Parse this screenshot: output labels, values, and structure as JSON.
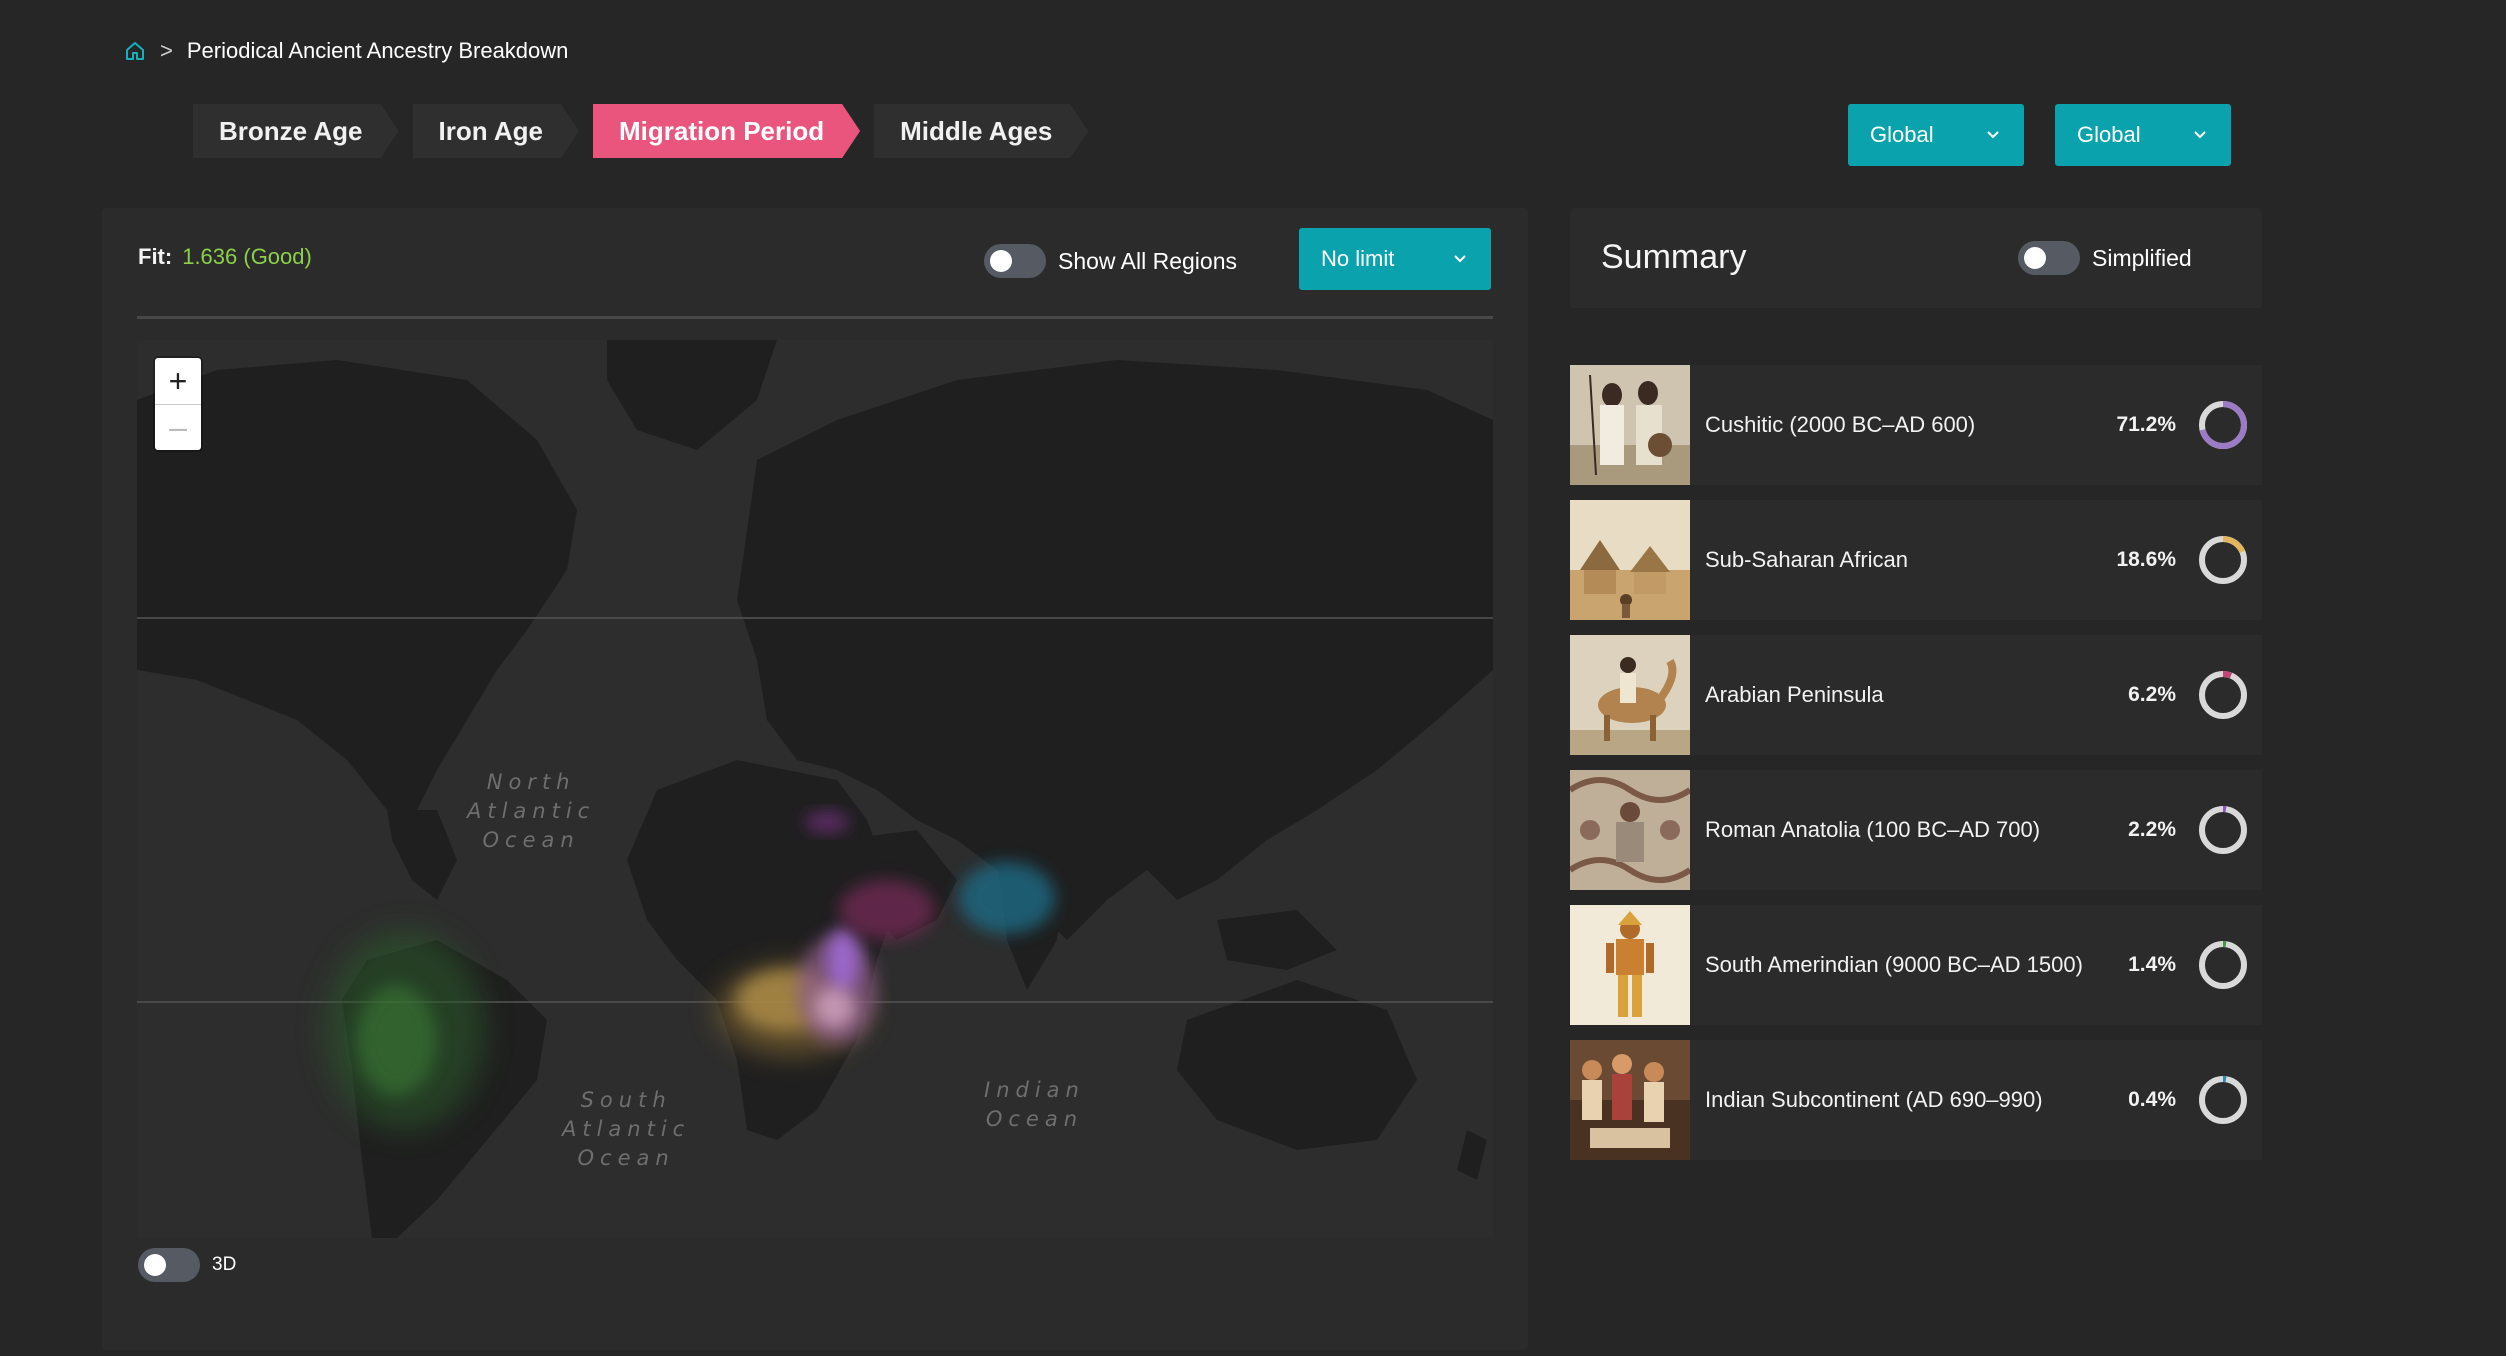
{
  "breadcrumb": {
    "home_icon": "home-icon",
    "separator": ">",
    "title": "Periodical Ancient Ancestry Breakdown"
  },
  "tabs": [
    {
      "label": "Bronze Age",
      "active": false
    },
    {
      "label": "Iron Age",
      "active": false
    },
    {
      "label": "Migration Period",
      "active": true
    },
    {
      "label": "Middle Ages",
      "active": false
    }
  ],
  "region_dropdowns": [
    {
      "value": "Global"
    },
    {
      "value": "Global"
    }
  ],
  "map_panel": {
    "fit_label": "Fit:",
    "fit_value": "1.636 (Good)",
    "show_all_regions_label": "Show All Regions",
    "limit_dropdown_value": "No limit",
    "zoom_in_label": "+",
    "zoom_out_label": "–",
    "toggle_3d_label": "3D",
    "oceans": {
      "north_atlantic": [
        "North",
        "Atlantic",
        "Ocean"
      ],
      "south_atlantic": [
        "South",
        "Atlantic",
        "Ocean"
      ],
      "indian": [
        "Indian",
        "Ocean"
      ]
    }
  },
  "summary": {
    "title": "Summary",
    "simplified_label": "Simplified",
    "items": [
      {
        "label": "Cushitic (2000 BC–AD 600)",
        "percent": "71.2%",
        "fraction": 0.712,
        "color": "#9b7bc4"
      },
      {
        "label": "Sub-Saharan African",
        "percent": "18.6%",
        "fraction": 0.186,
        "color": "#e2b65e"
      },
      {
        "label": "Arabian Peninsula",
        "percent": "6.2%",
        "fraction": 0.062,
        "color": "#c2457a"
      },
      {
        "label": "Roman Anatolia (100 BC–AD 700)",
        "percent": "2.2%",
        "fraction": 0.022,
        "color": "#8b57c0"
      },
      {
        "label": "South Amerindian (9000 BC–AD 1500)",
        "percent": "1.4%",
        "fraction": 0.014,
        "color": "#3f9a44"
      },
      {
        "label": "Indian Subcontinent (AD 690–990)",
        "percent": "0.4%",
        "fraction": 0.004,
        "color": "#2a8db5"
      }
    ]
  },
  "colors": {
    "accent_teal": "#0aa3ad",
    "active_tab": "#e9557c",
    "fit_good": "#8bd047"
  }
}
